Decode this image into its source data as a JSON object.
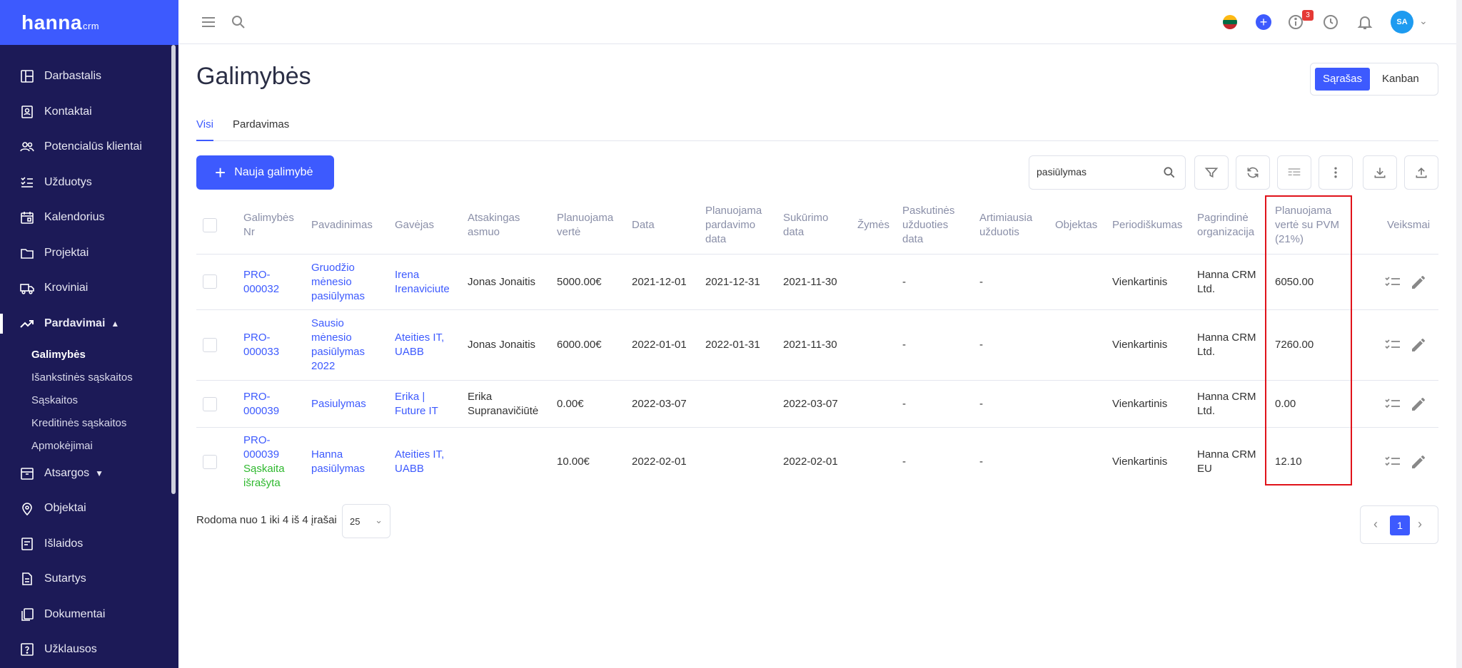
{
  "app": {
    "logo": "hanna",
    "logo_suffix": "crm"
  },
  "sidebar": {
    "items": [
      {
        "label": "Darbastalis",
        "icon": "dashboard-icon"
      },
      {
        "label": "Kontaktai",
        "icon": "contacts-icon"
      },
      {
        "label": "Potencialūs klientai",
        "icon": "leads-icon"
      },
      {
        "label": "Užduotys",
        "icon": "tasks-icon"
      },
      {
        "label": "Kalendorius",
        "icon": "calendar-icon"
      },
      {
        "label": "Projektai",
        "icon": "folder-icon"
      },
      {
        "label": "Kroviniai",
        "icon": "truck-icon"
      },
      {
        "label": "Pardavimai",
        "icon": "trending-icon",
        "expanded": true
      },
      {
        "label": "Atsargos",
        "icon": "inventory-icon"
      },
      {
        "label": "Objektai",
        "icon": "location-icon"
      },
      {
        "label": "Išlaidos",
        "icon": "expenses-icon"
      },
      {
        "label": "Sutartys",
        "icon": "contract-icon"
      },
      {
        "label": "Dokumentai",
        "icon": "documents-icon"
      },
      {
        "label": "Užklausos",
        "icon": "question-icon"
      }
    ],
    "sub_items": [
      "Galimybės",
      "Išankstinės sąskaitos",
      "Sąskaitos",
      "Kreditinės sąskaitos",
      "Apmokėjimai"
    ]
  },
  "topbar": {
    "notification_count": "3",
    "avatar_initials": "SA"
  },
  "page": {
    "title": "Galimybės",
    "view_list": "Sąrašas",
    "view_kanban": "Kanban",
    "tabs": [
      "Visi",
      "Pardavimas"
    ],
    "new_button": "Nauja galimybė",
    "search_value": "pasiūlymas"
  },
  "table": {
    "headers": {
      "nr": "Galimybės Nr",
      "name": "Pavadinimas",
      "receiver": "Gavėjas",
      "responsible": "Atsakingas asmuo",
      "planned_value": "Planuojama vertė",
      "date": "Data",
      "planned_sale_date": "Planuojama pardavimo data",
      "created_date": "Sukūrimo data",
      "tags": "Žymės",
      "last_task_date": "Paskutinės užduoties data",
      "next_task": "Artimiausia užduotis",
      "object": "Objektas",
      "periodicity": "Periodiškumas",
      "organization": "Pagrindinė organizacija",
      "planned_value_vat": "Planuojama vertė su PVM (21%)",
      "actions": "Veiksmai"
    },
    "rows": [
      {
        "nr": "PRO-000032",
        "status": "",
        "name": "Gruodžio mėnesio pasiūlymas",
        "receiver": "Irena Irenaviciute",
        "responsible": "Jonas Jonaitis",
        "planned_value": "5000.00€",
        "date": "2021-12-01",
        "planned_sale_date": "2021-12-31",
        "created_date": "2021-11-30",
        "last_task_date": "-",
        "next_task": "-",
        "periodicity": "Vienkartinis",
        "organization": "Hanna CRM Ltd.",
        "planned_value_vat": "6050.00"
      },
      {
        "nr": "PRO-000033",
        "status": "",
        "name": "Sausio mėnesio pasiūlymas 2022",
        "receiver": "Ateities IT, UABB",
        "responsible": "Jonas Jonaitis",
        "planned_value": "6000.00€",
        "date": "2022-01-01",
        "planned_sale_date": "2022-01-31",
        "created_date": "2021-11-30",
        "last_task_date": "-",
        "next_task": "-",
        "periodicity": "Vienkartinis",
        "organization": "Hanna CRM Ltd.",
        "planned_value_vat": "7260.00"
      },
      {
        "nr": "PRO-000039",
        "status": "",
        "name": "Pasiulymas",
        "receiver": "Erika | Future IT",
        "responsible": "Erika Supranavičiūtė",
        "planned_value": "0.00€",
        "date": "2022-03-07",
        "planned_sale_date": "",
        "created_date": "2022-03-07",
        "last_task_date": "-",
        "next_task": "-",
        "periodicity": "Vienkartinis",
        "organization": "Hanna CRM Ltd.",
        "planned_value_vat": "0.00"
      },
      {
        "nr": "PRO-000039",
        "status": "Sąskaita išrašyta",
        "name": "Hanna pasiūlymas",
        "receiver": "Ateities IT, UABB",
        "responsible": "",
        "planned_value": "10.00€",
        "date": "2022-02-01",
        "planned_sale_date": "",
        "created_date": "2022-02-01",
        "last_task_date": "-",
        "next_task": "-",
        "periodicity": "Vienkartinis",
        "organization": "Hanna CRM EU",
        "planned_value_vat": "12.10"
      }
    ]
  },
  "footer": {
    "showing": "Rodoma nuo 1 iki 4 iš 4 įrašai",
    "page_size": "25",
    "current_page": "1"
  },
  "colors": {
    "sidebar": "#1c1a57",
    "accent": "#3d5afe",
    "highlight": "#e0121a"
  }
}
